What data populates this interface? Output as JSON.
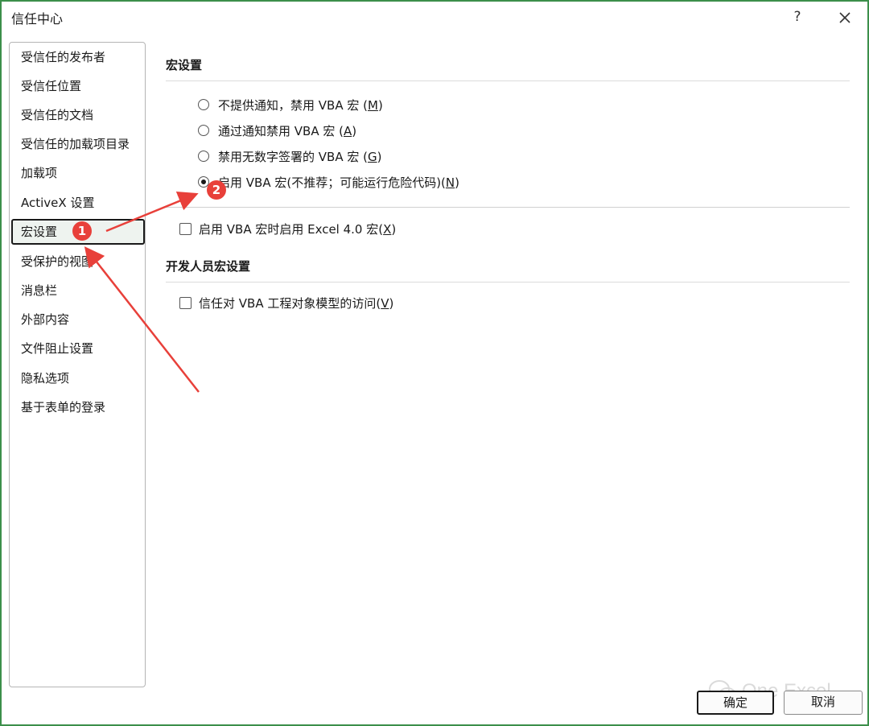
{
  "window": {
    "title": "信任中心",
    "help_label": "?"
  },
  "sidebar": {
    "items": [
      {
        "label": "受信任的发布者"
      },
      {
        "label": "受信任位置"
      },
      {
        "label": "受信任的文档"
      },
      {
        "label": "受信任的加载项目录"
      },
      {
        "label": "加载项"
      },
      {
        "label": "ActiveX 设置"
      },
      {
        "label": "宏设置",
        "selected": true
      },
      {
        "label": "受保护的视图"
      },
      {
        "label": "消息栏"
      },
      {
        "label": "外部内容"
      },
      {
        "label": "文件阻止设置"
      },
      {
        "label": "隐私选项"
      },
      {
        "label": "基于表单的登录"
      }
    ]
  },
  "macro_settings": {
    "header": "宏设置",
    "options": [
      {
        "label": "不提供通知，禁用 VBA 宏 (",
        "key": "M",
        "suffix": ")",
        "checked": false
      },
      {
        "label": "通过通知禁用 VBA 宏 (",
        "key": "A",
        "suffix": ")",
        "checked": false
      },
      {
        "label": "禁用无数字签署的 VBA 宏 (",
        "key": "G",
        "suffix": ")",
        "checked": false
      },
      {
        "label": "启用 VBA 宏(不推荐；可能运行危险代码)(",
        "key": "N",
        "suffix": ")",
        "checked": true
      }
    ],
    "excel4_checkbox": {
      "label": "启用 VBA 宏时启用 Excel 4.0 宏(",
      "key": "X",
      "suffix": ")",
      "checked": false
    }
  },
  "developer_settings": {
    "header": "开发人员宏设置",
    "vba_access_checkbox": {
      "label": "信任对 VBA 工程对象模型的访问(",
      "key": "V",
      "suffix": ")",
      "checked": false
    }
  },
  "buttons": {
    "ok": "确定",
    "cancel": "取消"
  },
  "watermark": {
    "text": "One Excel"
  },
  "annotations": {
    "badge_1": "1",
    "badge_2": "2",
    "color": "#e8403a"
  }
}
